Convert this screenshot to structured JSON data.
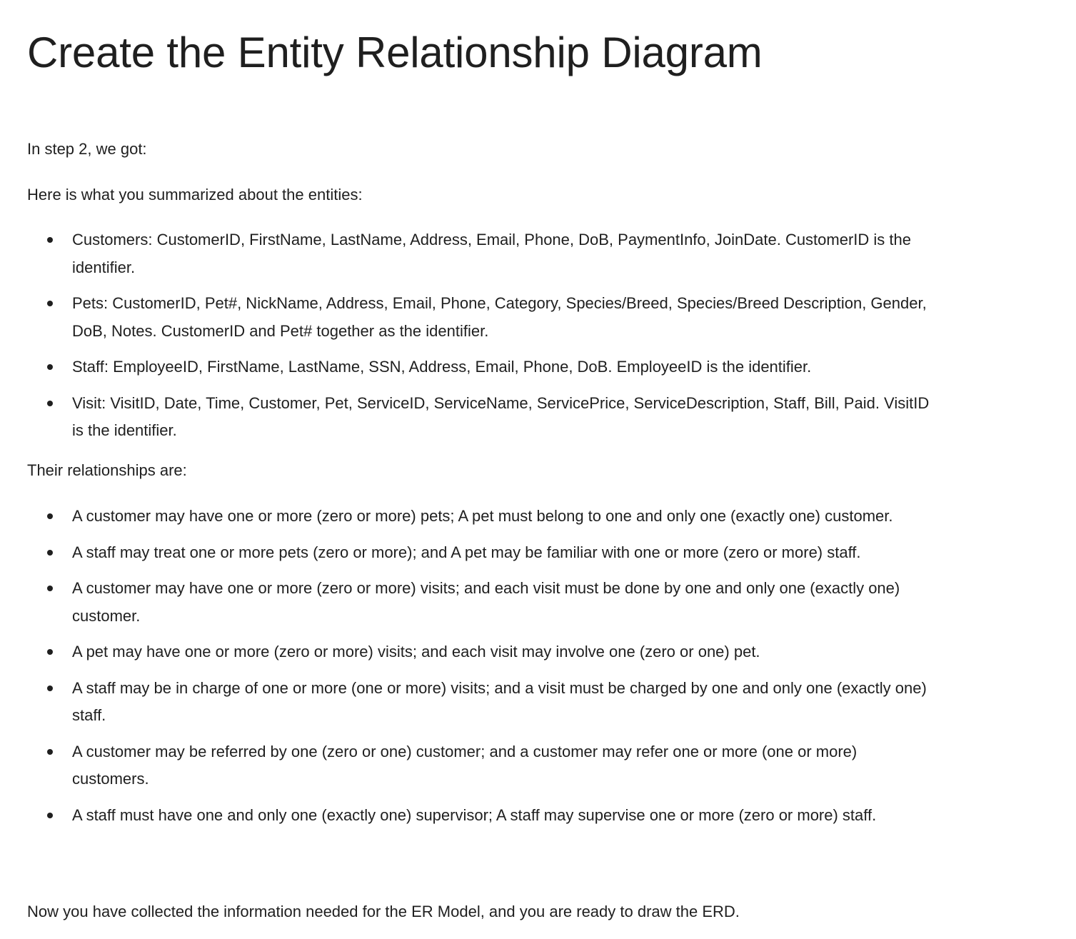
{
  "heading": "Create the Entity Relationship Diagram",
  "intro": "In step 2, we got:",
  "entities_intro": "Here is what you summarized about the entities:",
  "entities": [
    "Customers: CustomerID, FirstName, LastName, Address, Email, Phone, DoB, PaymentInfo, JoinDate. CustomerID is the identifier.",
    "Pets: CustomerID, Pet#, NickName, Address, Email, Phone, Category, Species/Breed, Species/Breed Description, Gender, DoB, Notes. CustomerID and Pet# together as the identifier.",
    "Staff: EmployeeID, FirstName, LastName, SSN, Address, Email, Phone, DoB. EmployeeID is the identifier.",
    "Visit: VisitID, Date, Time, Customer, Pet, ServiceID, ServiceName, ServicePrice, ServiceDescription, Staff, Bill, Paid. VisitID is the identifier."
  ],
  "relationships_intro": "Their relationships are:",
  "relationships": [
    "A customer may have one or more (zero or more) pets; A pet must belong to one and only one (exactly one) customer.",
    "A staff may treat one or more pets (zero or more); and A pet may be familiar with one or more (zero or more) staff.",
    "A customer may have one or more (zero or more) visits; and each visit must be done by one and only one (exactly one) customer.",
    "A pet may have one or more (zero or more) visits; and each visit may involve one (zero or one) pet.",
    "A staff may be in charge of one or more (one or more) visits; and a visit must be charged by one and only one (exactly one) staff.",
    "A customer may be referred by one (zero or one) customer; and a customer may refer one or more (one or more) customers.",
    "A staff must have one and only one (exactly one) supervisor; A staff may supervise one or more (zero or more) staff."
  ],
  "conclusion": "Now you have collected the information needed for the ER Model, and you are ready to draw the ERD."
}
